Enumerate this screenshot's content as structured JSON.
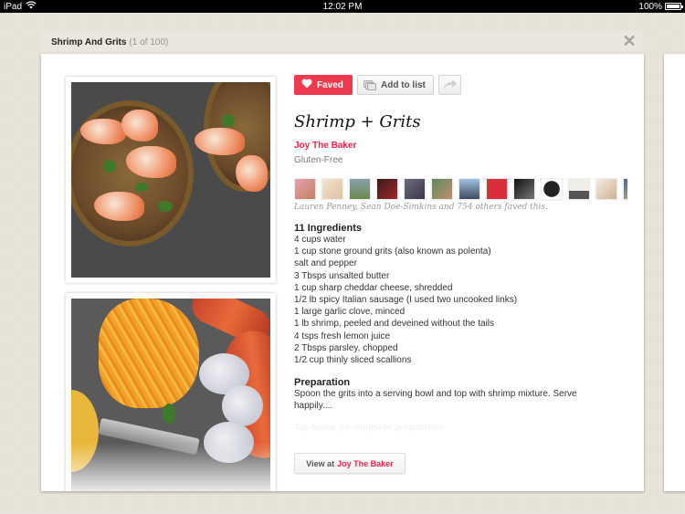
{
  "status_bar": {
    "device": "iPad",
    "time": "12:02 PM",
    "battery": "100%"
  },
  "header": {
    "title": "Shrimp And Grits",
    "count": "(1 of 100)",
    "close_icon": "close-x-icon"
  },
  "actions": {
    "faved_label": "Faved",
    "add_to_list_label": "Add to list",
    "share_icon": "share-arrow-icon",
    "accent_color": "#ee3a4e"
  },
  "recipe": {
    "title": "Shrimp + Grits",
    "source": "Joy The Baker",
    "diet": "Gluten-Free",
    "faved_by_text": "Lauren Penney, Sean Doe-Simkins and 754 others faved this.",
    "avatar_count": 13,
    "ingredients_title": "11 Ingredients",
    "ingredients": [
      "4 cups water",
      "1 cup stone ground grits (also known as polenta)",
      "salt and pepper",
      "3 Tbsps unsalted butter",
      "1 cup sharp cheddar cheese, shredded",
      "1/2 lb spicy Italian sausage (I used two uncooked links)",
      "1 large garlic clove, minced",
      "1 lb shrimp, peeled and deveined without the tails",
      "4 tsps fresh lemon juice",
      "2 Tbsps parsley, chopped",
      "1/2 cup thinly sliced scallions"
    ],
    "preparation_title": "Preparation",
    "preparation_text": "Spoon the grits into a serving bowl and top with shrimp mixture.  Serve happily....",
    "tap_more": "Tap below for complete preparation"
  },
  "view_button": {
    "prefix": "View at",
    "source": "Joy The Baker"
  },
  "images": [
    {
      "name": "finished-dish-photo",
      "description": "Shrimp and grits in bowls"
    },
    {
      "name": "ingredients-photo",
      "description": "Cheese, sausage, shrimp and polenta"
    }
  ]
}
